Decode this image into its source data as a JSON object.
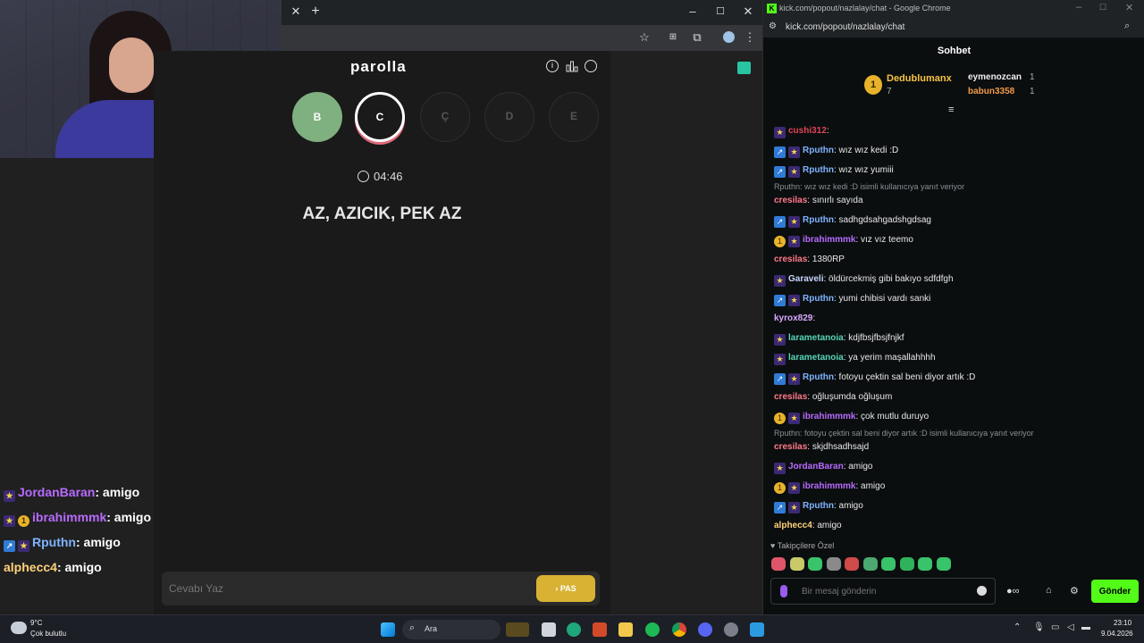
{
  "webcam": {},
  "browser": {
    "addr_icons": [
      "star-icon",
      "translate-icon",
      "extensions-icon",
      "profile-icon",
      "menu-icon"
    ]
  },
  "game": {
    "title": "parolla",
    "letters": [
      {
        "label": "B",
        "state": "correct",
        "color": "#7fb07f"
      },
      {
        "label": "C",
        "state": "active"
      },
      {
        "label": "Ç",
        "state": "pending"
      },
      {
        "label": "D",
        "state": "pending"
      },
      {
        "label": "E",
        "state": "pending"
      }
    ],
    "timer": "04:46",
    "clue": "AZ, AZICIK, PEK AZ",
    "answer_placeholder": "Cevabı Yaz",
    "pass_label": "PAS"
  },
  "chat_window": {
    "title": "kick.com/popout/nazlalay/chat - Google Chrome",
    "url": "kick.com/popout/nazlalay/chat",
    "header": "Sohbet",
    "leaderboard": {
      "rank": "1",
      "top_user": "Dedublumanx",
      "top_count": "7",
      "others": [
        {
          "name": "eymenozcan",
          "count": "1"
        },
        {
          "name": "babun3358",
          "count": "1"
        }
      ]
    },
    "messages": [
      {
        "user": "cushi312",
        "text": ":",
        "color": "#e0445a",
        "badges": [
          "star"
        ]
      },
      {
        "user": "Rputhn",
        "text": ": wız wız kedi :D",
        "color": "#7fb3ff",
        "badges": [
          "blue",
          "star"
        ]
      },
      {
        "user": "Rputhn",
        "text": ": wız wız yumiii",
        "color": "#7fb3ff",
        "badges": [
          "blue",
          "star"
        ]
      },
      {
        "reply": "Rputhn: wız wız kedi :D isimli kullanıcıya yanıt veriyor"
      },
      {
        "user": "cresilas",
        "text": ": sınırlı sayıda",
        "color": "#ff7a8a",
        "badges": []
      },
      {
        "user": "Rputhn",
        "text": ": sadhgdsahgadshgdsag",
        "color": "#7fb3ff",
        "badges": [
          "blue",
          "star"
        ]
      },
      {
        "user": "ibrahimmmk",
        "text": ": vız vız teemo",
        "color": "#b76bff",
        "badges": [
          "gold",
          "star"
        ]
      },
      {
        "user": "cresilas",
        "text": ": 1380RP",
        "color": "#ff7a8a",
        "badges": []
      },
      {
        "user": "Garaveli",
        "text": ": öldürcekmiş gibi bakıyo sdfdfgh",
        "color": "#c8d6ff",
        "badges": [
          "star"
        ]
      },
      {
        "user": "Rputhn",
        "text": ": yumi chibisi vardı sanki",
        "color": "#7fb3ff",
        "badges": [
          "blue",
          "star"
        ]
      },
      {
        "user": "kyrox829",
        "text": ":",
        "color": "#d9a8ff",
        "badges": []
      },
      {
        "user": "larametanoia",
        "text": ": kdjfbsjfbsjfnjkf",
        "color": "#56d6b8",
        "badges": [
          "star"
        ]
      },
      {
        "user": "larametanoia",
        "text": ": ya yerim maşallahhhh",
        "color": "#56d6b8",
        "badges": [
          "star"
        ]
      },
      {
        "user": "Rputhn",
        "text": ": fotoyu çektin sal beni diyor artık :D",
        "color": "#7fb3ff",
        "badges": [
          "blue",
          "star"
        ]
      },
      {
        "user": "cresilas",
        "text": ": oğluşumda oğluşum",
        "color": "#ff7a8a",
        "badges": []
      },
      {
        "user": "ibrahimmmk",
        "text": ": çok mutlu duruyo",
        "color": "#b76bff",
        "badges": [
          "gold",
          "star"
        ]
      },
      {
        "reply": "Rputhn: fotoyu çektin sal beni diyor artık :D isimli kullanıcıya yanıt veriyor"
      },
      {
        "user": "cresilas",
        "text": ": skjdhsadhsajd",
        "color": "#ff7a8a",
        "badges": []
      },
      {
        "user": "JordanBaran",
        "text": ": amigo",
        "color": "#b76bff",
        "badges": [
          "star"
        ]
      },
      {
        "user": "ibrahimmmk",
        "text": ": amigo",
        "color": "#b76bff",
        "badges": [
          "gold",
          "star"
        ]
      },
      {
        "user": "Rputhn",
        "text": ": amigo",
        "color": "#7fb3ff",
        "badges": [
          "blue",
          "star"
        ]
      },
      {
        "user": "alphecc4",
        "text": ": amigo",
        "color": "#ffd27a",
        "badges": []
      }
    ],
    "followers_only": "Takipçilere Özel",
    "input_placeholder": "Bir mesaj gönderin",
    "send_label": "Gönder"
  },
  "overlay_chat": [
    {
      "user": "JordanBaran",
      "text": ": amigo",
      "color": "#b76bff",
      "badges": [
        "star"
      ]
    },
    {
      "user": "ibrahimmmk",
      "text": ": amigo",
      "color": "#b76bff",
      "badges": [
        "star",
        "gold"
      ]
    },
    {
      "user": "Rputhn",
      "text": ": amigo",
      "color": "#7fb3ff",
      "badges": [
        "blue",
        "star"
      ]
    },
    {
      "user": "alphecc4",
      "text": ": amigo",
      "color": "#ffd27a",
      "badges": []
    }
  ],
  "taskbar": {
    "weather_temp": "9°C",
    "weather_desc": "Çok bulutlu",
    "search_label": "Ara",
    "time": "23:10",
    "date": "9.04.2026"
  }
}
